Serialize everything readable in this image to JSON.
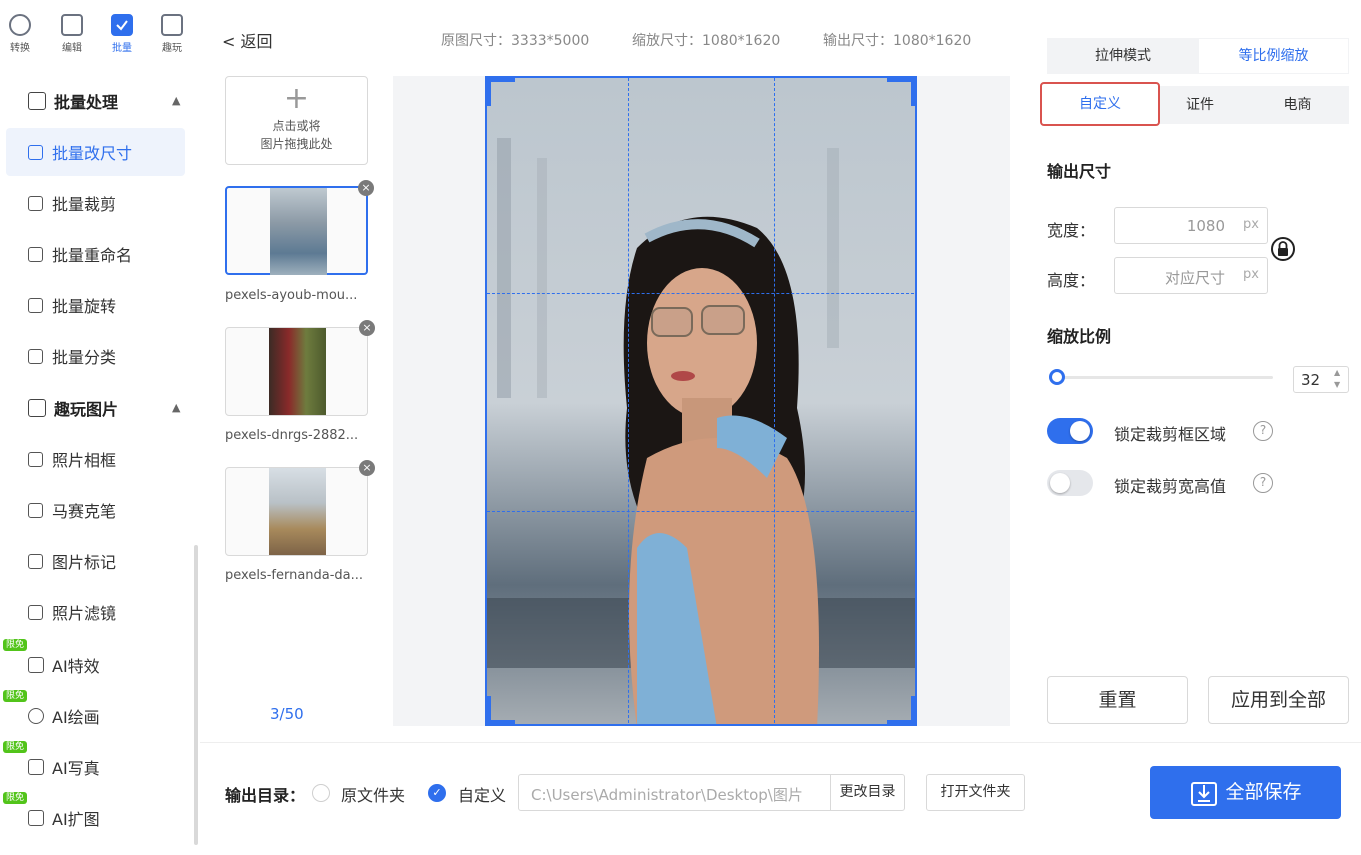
{
  "topnav": [
    {
      "label": "转换",
      "icon": "convert-icon"
    },
    {
      "label": "编辑",
      "icon": "edit-icon"
    },
    {
      "label": "批量",
      "icon": "batch-icon",
      "active": true
    },
    {
      "label": "趣玩",
      "icon": "fun-icon"
    }
  ],
  "sidebar": {
    "group_batch": {
      "label": "批量处理",
      "icon": "batch-process-icon"
    },
    "batch_items": [
      {
        "label": "批量改尺寸",
        "icon": "resize-icon",
        "selected": true
      },
      {
        "label": "批量裁剪",
        "icon": "crop-icon"
      },
      {
        "label": "批量重命名",
        "icon": "rename-icon"
      },
      {
        "label": "批量旋转",
        "icon": "rotate-icon"
      },
      {
        "label": "批量分类",
        "icon": "classify-icon"
      }
    ],
    "group_fun": {
      "label": "趣玩图片",
      "icon": "fun-image-icon"
    },
    "fun_items": [
      {
        "label": "照片相框",
        "icon": "frame-icon"
      },
      {
        "label": "马赛克笔",
        "icon": "mosaic-icon"
      },
      {
        "label": "图片标记",
        "icon": "mark-icon"
      },
      {
        "label": "照片滤镜",
        "icon": "filter-icon"
      }
    ],
    "ai_badge": "限免",
    "ai_items": [
      {
        "label": "AI特效",
        "icon": "ai-effect-icon"
      },
      {
        "label": "AI绘画",
        "icon": "ai-paint-icon"
      },
      {
        "label": "AI写真",
        "icon": "ai-portrait-icon"
      },
      {
        "label": "AI扩图",
        "icon": "ai-expand-icon"
      }
    ]
  },
  "header": {
    "back": "< 返回",
    "original_size": "原图尺寸：3333*5000",
    "scaled_size": "缩放尺寸：1080*1620",
    "output_size": "输出尺寸：1080*1620"
  },
  "thumbs": {
    "add_line1": "点击或将",
    "add_line2": "图片拖拽此处",
    "files": [
      {
        "name": "pexels-ayoub-mou..."
      },
      {
        "name": "pexels-dnrgs-2882..."
      },
      {
        "name": "pexels-fernanda-da..."
      }
    ],
    "counter": "3/50"
  },
  "panel": {
    "mode_stretch": "拉伸模式",
    "mode_proportional": "等比例缩放",
    "sub_custom": "自定义",
    "sub_id": "证件",
    "sub_ecommerce": "电商",
    "output_size_title": "输出尺寸",
    "width_label": "宽度：",
    "width_value": "1080",
    "height_label": "高度：",
    "height_value": "对应尺寸",
    "unit": "px",
    "scale_title": "缩放比例",
    "scale_value": "32",
    "lock_crop_area": "锁定裁剪框区域",
    "lock_crop_area_on": true,
    "lock_crop_ratio": "锁定裁剪宽高值",
    "lock_crop_ratio_on": false,
    "reset": "重置",
    "apply_all": "应用到全部"
  },
  "bottom": {
    "output_dir_label": "输出目录：",
    "option_original": "原文件夹",
    "option_custom": "自定义",
    "path": "C:\\Users\\Administrator\\Desktop\\图片",
    "change_dir": "更改目录",
    "open_folder": "打开文件夹",
    "save_all": "全部保存"
  },
  "colors": {
    "accent": "#2f6fed",
    "highlight_box": "#d9534f",
    "toggle_on": "#2f6fed",
    "badge": "#52c41a"
  }
}
